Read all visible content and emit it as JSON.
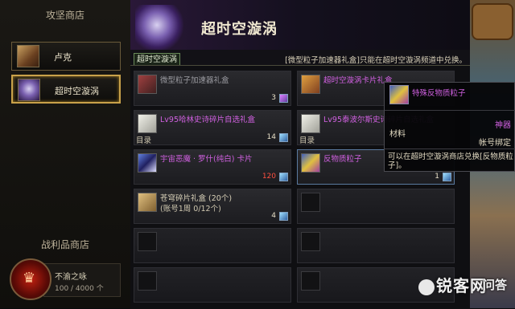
{
  "left": {
    "shop_title": "攻坚商店",
    "shops": [
      {
        "label": "卢克",
        "icon": "luke-portrait-icon"
      },
      {
        "label": "超时空漩涡",
        "icon": "vortex-icon",
        "selected": true
      }
    ],
    "trophy_title": "战利品商店",
    "trophy": {
      "name": "不渝之咏",
      "count": "100 / 4000 个"
    }
  },
  "header": {
    "title": "超时空漩涡"
  },
  "tab": {
    "label": "超时空漩涡"
  },
  "notice": "[微型粒子加速器礼盒]只能在超时空漩涡频道中兑换。",
  "items": [
    {
      "name": "微型粒子加速器礼盒",
      "color": "#9a9aa0",
      "qty": "3",
      "icon": "gift-box-icon"
    },
    {
      "name": "超时空漩涡卡片礼盒",
      "color": "#d060e0",
      "qty": "",
      "icon": "card-box-icon"
    },
    {
      "name": "Lv95哈林史诗碎片自选礼盒",
      "color": "#d060e0",
      "category": "目录",
      "qty": "14",
      "icon": "epic-box-icon"
    },
    {
      "name": "Lv95泰波尔斯史诗碎片自选礼盒",
      "color": "#d060e0",
      "category": "目录",
      "qty": "",
      "icon": "epic-box-icon"
    },
    {
      "name": "宇宙恶魔 · 罗什(纯白) 卡片",
      "color": "#d060e0",
      "qty": "120",
      "icon": "card-icon"
    },
    {
      "name": "反物质粒子",
      "color": "#d060e0",
      "qty": "1",
      "icon": "particle-icon"
    },
    {
      "name": "苍穹碎片礼盒 (20个)",
      "color": "#d8d0b8",
      "sub": "(账号1周 0/12个)",
      "qty": "4",
      "icon": "shard-box-icon"
    }
  ],
  "tooltip": {
    "name": "特殊反物质粒子",
    "category": "材料",
    "grade": "神器",
    "bind": "帐号绑定",
    "desc": "可以在超时空漩涡商店兑换[反物质粒子]。"
  },
  "watermark": {
    "text": "锐客网",
    "text2": "问答"
  }
}
